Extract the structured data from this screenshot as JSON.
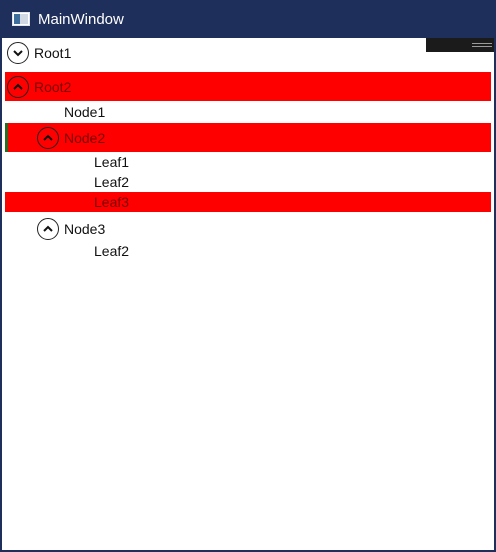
{
  "window": {
    "title": "MainWindow",
    "title_bar_color": "#1f2f5c",
    "app_icon": "window-app-icon"
  },
  "tree": {
    "selection_color": "#ff0000",
    "items": [
      {
        "label": "Root1",
        "level": 0,
        "state": "collapsed",
        "selected": false
      },
      {
        "label": "Root2",
        "level": 0,
        "state": "expanded",
        "selected": true
      },
      {
        "label": "Node1",
        "level": 1,
        "state": "leaf",
        "selected": false
      },
      {
        "label": "Node2",
        "level": 1,
        "state": "expanded",
        "selected": true
      },
      {
        "label": "Leaf1",
        "level": 2,
        "state": "leaf",
        "selected": false
      },
      {
        "label": "Leaf2",
        "level": 2,
        "state": "leaf",
        "selected": false
      },
      {
        "label": "Leaf3",
        "level": 2,
        "state": "leaf",
        "selected": true
      },
      {
        "label": "Node3",
        "level": 1,
        "state": "expanded",
        "selected": false
      },
      {
        "label": "Leaf2",
        "level": 2,
        "state": "leaf",
        "selected": false
      }
    ]
  }
}
